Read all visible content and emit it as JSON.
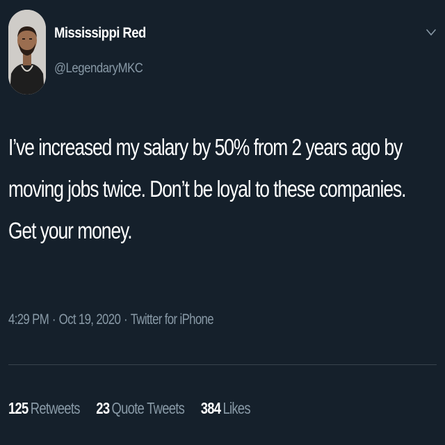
{
  "author": {
    "name": "Mississippi Red",
    "handle": "@LegendaryMKC"
  },
  "icons": {
    "avatar": "profile-photo",
    "menu": "chevron-down-icon"
  },
  "tweet": {
    "text_lines": [
      "I’ve increased my salary by 50% from 2 years ago by",
      "moving jobs twice. Don’t be loyal to these companies.",
      "Get your money."
    ]
  },
  "meta": {
    "time": "4:29 PM",
    "date": "Oct 19, 2020",
    "source": "Twitter for iPhone",
    "separator": "·"
  },
  "stats": {
    "retweets": {
      "count": "125",
      "label": "Retweets"
    },
    "quote_tweets": {
      "count": "23",
      "label": "Quote Tweets"
    },
    "likes": {
      "count": "384",
      "label": "Likes"
    }
  },
  "colors": {
    "background": "#15202b",
    "primary_text": "#ffffff",
    "secondary_text": "#8899a6",
    "divider": "#38444d"
  }
}
